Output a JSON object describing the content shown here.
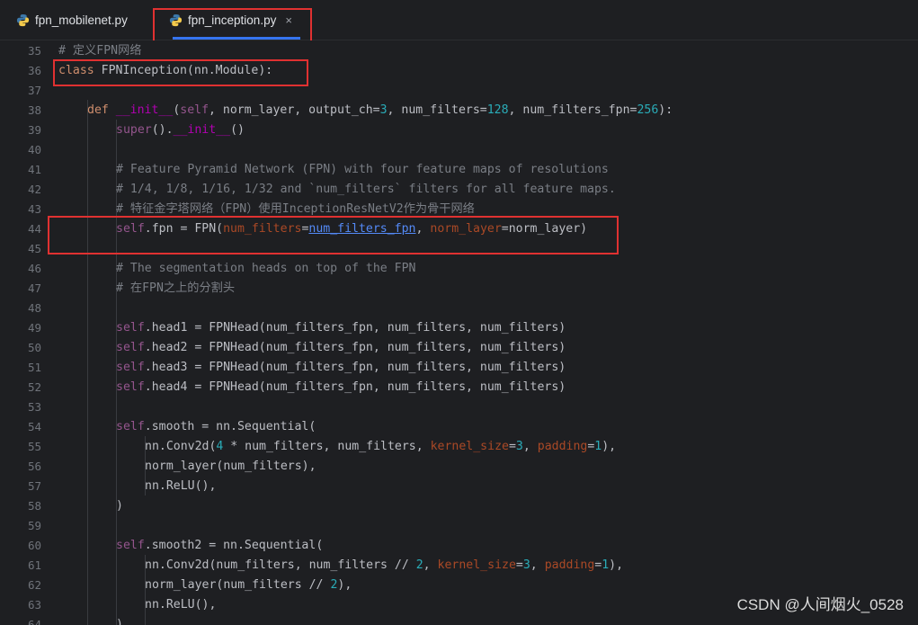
{
  "tabs": [
    {
      "label": "fpn_mobilenet.py",
      "active": false
    },
    {
      "label": "fpn_inception.py",
      "active": true,
      "close": "×"
    }
  ],
  "lines": {
    "l35": {
      "n": "35",
      "t0": "# 定义FPN网络"
    },
    "l36": {
      "n": "36",
      "t0": "class",
      "t1": " FPNInception(nn.Module):"
    },
    "l37": {
      "n": "37"
    },
    "l38": {
      "n": "38",
      "t0": "def",
      "t1": " ",
      "t2": "__init__",
      "t3": "(",
      "t4": "self",
      "t5": ", norm_layer, output_ch=",
      "t6": "3",
      "t7": ", num_filters=",
      "t8": "128",
      "t9": ", num_filters_fpn=",
      "t10": "256",
      "t11": "):"
    },
    "l39": {
      "n": "39",
      "t0": "super",
      "t1": "().",
      "t2": "__init__",
      "t3": "()"
    },
    "l40": {
      "n": "40"
    },
    "l41": {
      "n": "41",
      "t0": "# Feature Pyramid Network (FPN) with four feature maps of resolutions"
    },
    "l42": {
      "n": "42",
      "t0": "# 1/4, 1/8, 1/16, 1/32 and `num_filters` filters for all feature maps."
    },
    "l43": {
      "n": "43",
      "t0": "# 特征金字塔网络（FPN）使用InceptionResNetV2作为骨干网络"
    },
    "l44": {
      "n": "44",
      "t0": "self",
      "t1": ".fpn = FPN(",
      "t2": "num_filters",
      "t3": "=",
      "t4": "num_filters_fpn",
      "t5": ", ",
      "t6": "norm_layer",
      "t7": "=norm_layer)"
    },
    "l45": {
      "n": "45"
    },
    "l46": {
      "n": "46",
      "t0": "# The segmentation heads on top of the FPN"
    },
    "l47": {
      "n": "47",
      "t0": "# 在FPN之上的分割头"
    },
    "l48": {
      "n": "48"
    },
    "l49": {
      "n": "49",
      "t0": "self",
      "t1": ".head1 = FPNHead(num_filters_fpn, num_filters, num_filters)"
    },
    "l50": {
      "n": "50",
      "t0": "self",
      "t1": ".head2 = FPNHead(num_filters_fpn, num_filters, num_filters)"
    },
    "l51": {
      "n": "51",
      "t0": "self",
      "t1": ".head3 = FPNHead(num_filters_fpn, num_filters, num_filters)"
    },
    "l52": {
      "n": "52",
      "t0": "self",
      "t1": ".head4 = FPNHead(num_filters_fpn, num_filters, num_filters)"
    },
    "l53": {
      "n": "53"
    },
    "l54": {
      "n": "54",
      "t0": "self",
      "t1": ".smooth = nn.Sequential("
    },
    "l55": {
      "n": "55",
      "t0": "nn.Conv2d(",
      "t1": "4",
      "t2": " * num_filters, num_filters, ",
      "t3": "kernel_size",
      "t4": "=",
      "t5": "3",
      "t6": ", ",
      "t7": "padding",
      "t8": "=",
      "t9": "1",
      "t10": "),"
    },
    "l56": {
      "n": "56",
      "t0": "norm_layer(num_filters),"
    },
    "l57": {
      "n": "57",
      "t0": "nn.ReLU(),"
    },
    "l58": {
      "n": "58",
      "t0": ")"
    },
    "l59": {
      "n": "59"
    },
    "l60": {
      "n": "60",
      "t0": "self",
      "t1": ".smooth2 = nn.Sequential("
    },
    "l61": {
      "n": "61",
      "t0": "nn.Conv2d(num_filters, num_filters // ",
      "t1": "2",
      "t2": ", ",
      "t3": "kernel_size",
      "t4": "=",
      "t5": "3",
      "t6": ", ",
      "t7": "padding",
      "t8": "=",
      "t9": "1",
      "t10": "),"
    },
    "l62": {
      "n": "62",
      "t0": "norm_layer(num_filters // ",
      "t1": "2",
      "t2": "),"
    },
    "l63": {
      "n": "63",
      "t0": "nn.ReLU(),"
    },
    "l64": {
      "n": "64",
      "t0": ")"
    }
  },
  "watermark": "CSDN @人间烟火_0528",
  "colors": {
    "background": "#1e1f22",
    "keyword": "#cf8e6d",
    "self": "#94558d",
    "number": "#2aacb8",
    "kwarg": "#aa4926",
    "comment": "#7a7e85",
    "highlight": "#e03131",
    "tab_accent": "#3574f0"
  }
}
